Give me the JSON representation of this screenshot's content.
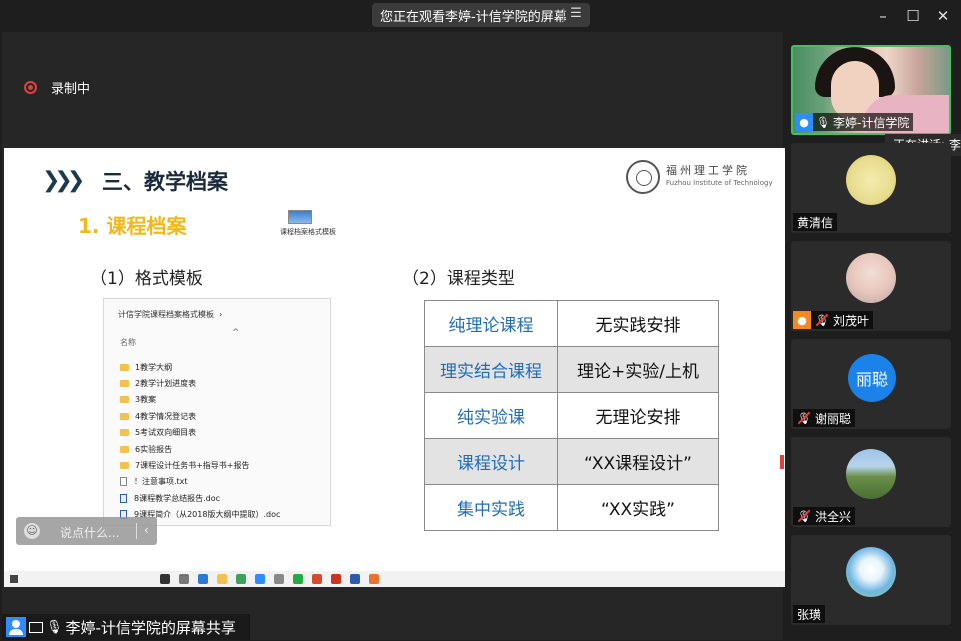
{
  "top_bar": {
    "viewing_text": "您正在观看李婷-计信学院的屏幕",
    "menu_icon": "menu-lines-icon",
    "window_controls": [
      "minimize-icon",
      "maximize-icon",
      "close-icon"
    ]
  },
  "recording": {
    "label": "录制中",
    "color": "#e04040"
  },
  "slide": {
    "section_title": "三、教学档案",
    "subsection_title": "1. 课程档案",
    "subsection_color": "#f2b81b",
    "logo_cn": "福州理工学院",
    "logo_en": "Fuzhou Institute of Technology",
    "thumbnail_caption": "课程档案格式模板",
    "left_heading": "（1）格式模板",
    "right_heading": "（2）课程类型",
    "explorer": {
      "path": "计信学院课程档案格式模板",
      "column_header": "名称",
      "items": [
        {
          "type": "folder",
          "name": "1教学大纲"
        },
        {
          "type": "folder",
          "name": "2教学计划进度表"
        },
        {
          "type": "folder",
          "name": "3教案"
        },
        {
          "type": "folder",
          "name": "4教学情况登记表"
        },
        {
          "type": "folder",
          "name": "5考试双向细目表"
        },
        {
          "type": "folder",
          "name": "6实验报告"
        },
        {
          "type": "folder",
          "name": "7课程设计任务书+指导书+报告"
        },
        {
          "type": "txt",
          "name": "！注意事项.txt"
        },
        {
          "type": "doc",
          "name": "8课程教学总结报告.doc"
        },
        {
          "type": "doc",
          "name": "9课程简介（从2018版大纲中提取）.doc"
        }
      ]
    },
    "course_types": [
      {
        "type": "纯理论课程",
        "arrangement": "无实践安排"
      },
      {
        "type": "理实结合课程",
        "arrangement": "理论+实验/上机"
      },
      {
        "type": "纯实验课",
        "arrangement": "无理论安排"
      },
      {
        "type": "课程设计",
        "arrangement": "“XX课程设计”"
      },
      {
        "type": "集中实践",
        "arrangement": "“XX实践”"
      }
    ]
  },
  "chat_input": {
    "placeholder": "说点什么...",
    "emoji_icon": "smile-icon",
    "collapse_icon": "chevron-left-icon"
  },
  "share_label": "李婷-计信学院的屏幕共享",
  "speaking_indicator": "正在讲话: 李",
  "participants": [
    {
      "name": "李婷-计信学院",
      "video": "camera",
      "mic": "on"
    },
    {
      "name": "黄清信",
      "video": "image",
      "mic": "none"
    },
    {
      "name": "刘茂叶",
      "video": "image",
      "mic": "muted"
    },
    {
      "name": "谢丽聪",
      "avatar_text": "丽聪",
      "avatar_color": "#1a82e8",
      "video": "letter",
      "mic": "muted"
    },
    {
      "name": "洪全兴",
      "video": "image",
      "mic": "muted"
    },
    {
      "name": "张璜",
      "video": "image",
      "mic": "none"
    }
  ]
}
